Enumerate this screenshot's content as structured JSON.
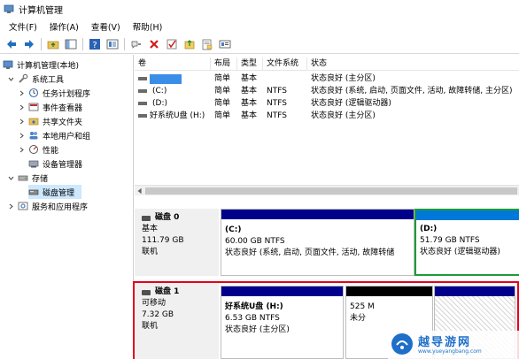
{
  "window": {
    "title": "计算机管理"
  },
  "menu": [
    "文件(F)",
    "操作(A)",
    "查看(V)",
    "帮助(H)"
  ],
  "toolbar": [
    "back-icon",
    "forward-icon",
    "folder-up-icon",
    "console-tree-icon",
    "help-icon",
    "properties-icon",
    "connect-icon",
    "delete-icon",
    "check-icon",
    "open-folder-icon",
    "export-icon",
    "view-icon"
  ],
  "tree": {
    "root": "计算机管理(本地)",
    "system_tools": "系统工具",
    "task_scheduler": "任务计划程序",
    "event_viewer": "事件查看器",
    "shared_folders": "共享文件夹",
    "local_users": "本地用户和组",
    "performance": "性能",
    "device_manager": "设备管理器",
    "storage": "存储",
    "disk_management": "磁盘管理",
    "services_apps": "服务和应用程序"
  },
  "volumes": {
    "headers": [
      "卷",
      "布局",
      "类型",
      "文件系统",
      "状态"
    ],
    "rows": [
      {
        "name": "",
        "layout": "简单",
        "type": "基本",
        "fs": "",
        "status": "状态良好 (主分区)"
      },
      {
        "name": "(C:)",
        "layout": "简单",
        "type": "基本",
        "fs": "NTFS",
        "status": "状态良好 (系统, 启动, 页面文件, 活动, 故障转储, 主分区)"
      },
      {
        "name": "(D:)",
        "layout": "简单",
        "type": "基本",
        "fs": "NTFS",
        "status": "状态良好 (逻辑驱动器)"
      },
      {
        "name": "好系统U盘 (H:)",
        "layout": "简单",
        "type": "基本",
        "fs": "NTFS",
        "status": "状态良好 (主分区)"
      }
    ]
  },
  "disk0": {
    "name": "磁盘 0",
    "type": "基本",
    "size": "111.79 GB",
    "status": "联机",
    "c": {
      "name": "(C:)",
      "size": "60.00 GB NTFS",
      "status": "状态良好 (系统, 启动, 页面文件, 活动, 故障转储"
    },
    "d": {
      "name": "(D:)",
      "size": "51.79 GB NTFS",
      "status": "状态良好 (逻辑驱动器)"
    }
  },
  "disk1": {
    "name": "磁盘 1",
    "type": "可移动",
    "size": "7.32 GB",
    "status": "联机",
    "h": {
      "name": "好系统U盘  (H:)",
      "size": "6.53 GB NTFS",
      "status": "状态良好 (主分区)"
    },
    "u": {
      "size": "525 M",
      "status": "未分"
    }
  },
  "watermark": {
    "text": "越导游网",
    "url": "www.yueyangbang.com"
  },
  "colors": {
    "primary_bar": "#00008b",
    "unallocated_bar": "#000000",
    "logical_bar": "#0078d7",
    "selection": "#cde8ff",
    "highlight_red": "#e3001b",
    "highlight_green": "#1f9a3a"
  }
}
